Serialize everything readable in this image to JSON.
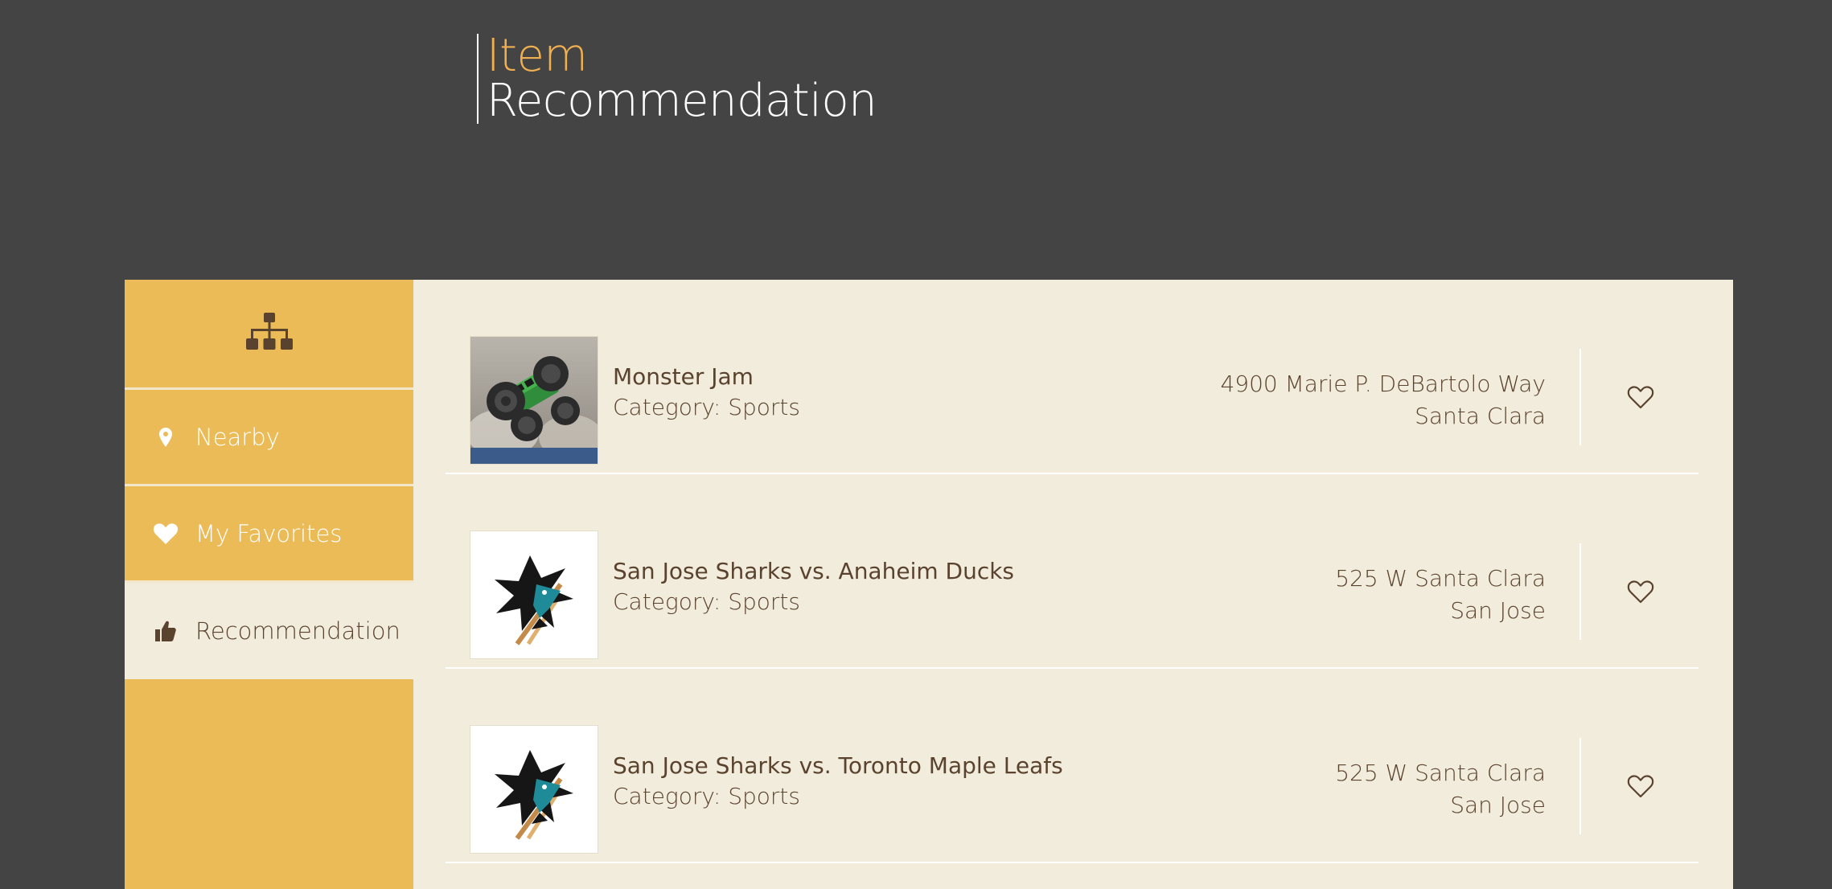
{
  "header": {
    "title_line1": "Item",
    "title_line2": "Recommendation"
  },
  "sidebar": {
    "logo_icon": "sitemap-icon",
    "items": [
      {
        "label": "Nearby",
        "icon": "map-pin-icon"
      },
      {
        "label": "My Favorites",
        "icon": "heart-icon"
      },
      {
        "label": "Recommendation",
        "icon": "thumbs-up-icon",
        "active": true
      }
    ]
  },
  "items": [
    {
      "name": "Monster Jam",
      "category": "Category: Sports",
      "address_line1": "4900 Marie P. DeBartolo Way",
      "address_line2": "Santa Clara",
      "thumb": "monster-truck-photo",
      "favorite": false
    },
    {
      "name": "San Jose Sharks vs. Anaheim Ducks",
      "category": "Category: Sports",
      "address_line1": "525 W Santa Clara",
      "address_line2": "San Jose",
      "thumb": "sharks-logo",
      "favorite": false
    },
    {
      "name": "San Jose Sharks vs. Toronto Maple Leafs",
      "category": "Category: Sports",
      "address_line1": "525 W Santa Clara",
      "address_line2": "San Jose",
      "thumb": "sharks-logo",
      "favorite": false
    }
  ],
  "colors": {
    "background": "#444444",
    "accent": "#f0b04f",
    "sidebar": "#ebbb58",
    "content": "#f2ecdc",
    "text": "#5a432e"
  }
}
